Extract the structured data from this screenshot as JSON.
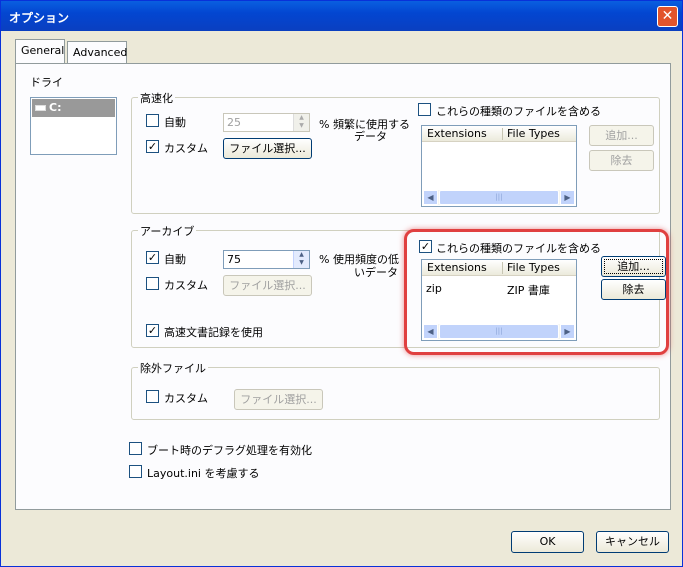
{
  "window": {
    "title": "オプション",
    "close_glyph": "✕"
  },
  "tabs": [
    {
      "label": "General"
    },
    {
      "label": "Advanced"
    }
  ],
  "drive": {
    "label": "ドライ",
    "selected": "C:"
  },
  "speed": {
    "title": "高速化",
    "auto_label": "自動",
    "auto_checked": false,
    "auto_value": "25",
    "custom_label": "カスタム",
    "custom_checked": true,
    "file_select": "ファイル選択...",
    "desc": "% 頻繁に使用する",
    "desc2": "データ",
    "include_label": "これらの種類のファイルを含める",
    "include_checked": false,
    "col_ext": "Extensions",
    "col_type": "File Types",
    "add": "追加...",
    "remove": "除去"
  },
  "archive": {
    "title": "アーカイブ",
    "auto_label": "自動",
    "auto_checked": true,
    "auto_value": "75",
    "custom_label": "カスタム",
    "custom_checked": false,
    "file_select": "ファイル選択...",
    "desc": "% 使用頻度の低",
    "desc2": "いデータ",
    "log_label": "高速文書記録を使用",
    "log_checked": true,
    "include_label": "これらの種類のファイルを含める",
    "include_checked": true,
    "col_ext": "Extensions",
    "col_type": "File Types",
    "rows": [
      {
        "ext": "zip",
        "type": "ZIP 書庫"
      }
    ],
    "add": "追加...",
    "remove": "除去"
  },
  "exclude": {
    "title": "除外ファイル",
    "custom_label": "カスタム",
    "custom_checked": false,
    "file_select": "ファイル選択..."
  },
  "boot_defrag_label": "ブート時のデフラグ処理を有効化",
  "layout_ini_label": "Layout.ini を考慮する",
  "ok": "OK",
  "cancel": "キャンセル",
  "check_glyph": "✓",
  "colors": {
    "highlight": "#e04040",
    "titlebar": "#0a5fe0"
  }
}
